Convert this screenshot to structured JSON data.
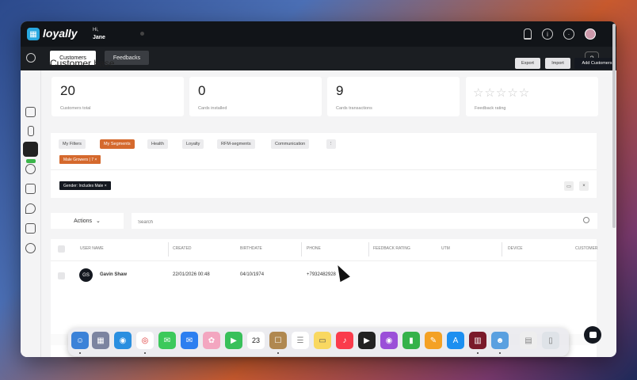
{
  "app": {
    "brand": "loyally",
    "greeting": "Hi,",
    "user": "Jane"
  },
  "subbar": {
    "tabs": [
      {
        "label": "Customers"
      },
      {
        "label": "Feedbacks"
      }
    ],
    "help": "?"
  },
  "page": {
    "title": "Customer base"
  },
  "header_buttons": {
    "export": "Export",
    "import": "Import",
    "add": "Add Customers"
  },
  "stats": [
    {
      "value": "20",
      "label": "Customers total"
    },
    {
      "value": "0",
      "label": "Cards installed"
    },
    {
      "value": "9",
      "label": "Cards transactions"
    },
    {
      "value": "☆☆☆☆☆",
      "label": "Feedback rating"
    }
  ],
  "filters": {
    "chips": [
      "My Filters",
      "My Segments",
      "Health",
      "Loyalty",
      "RFM-segments",
      "Communication"
    ],
    "segment_tag": "Male Growers   |   7   ×",
    "gender_tag": "Gender: Includes Male  ×"
  },
  "toolbar": {
    "actions": "Actions",
    "search_placeholder": "Search"
  },
  "table": {
    "headers": [
      "USER NAME",
      "CREATED",
      "BIRTHDATE",
      "PHONE",
      "FEEDBACK RATING",
      "UTM",
      "DEVICE",
      "CUSTOMER"
    ],
    "rows": [
      {
        "initials": "GS",
        "name": "Gavin Shaw",
        "created": "22/01/2026 00:48",
        "birthdate": "04/10/1974",
        "phone": "+7932482928"
      }
    ]
  },
  "dock": {
    "calendar_day": "23"
  },
  "colors": {
    "accent": "#d5692d",
    "dark": "#141820",
    "brand": "#29a8e0"
  }
}
